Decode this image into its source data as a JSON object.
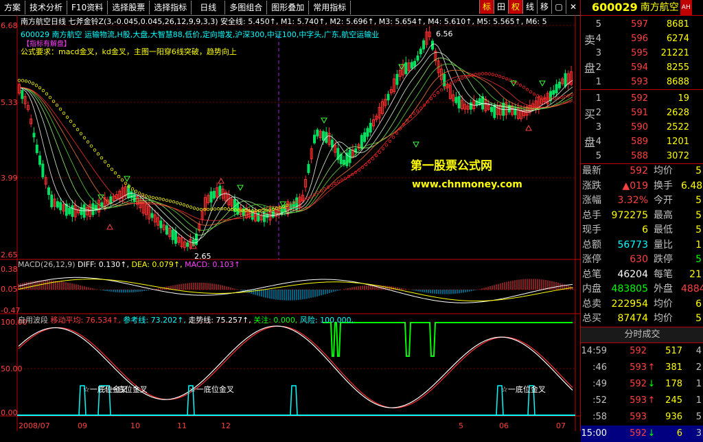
{
  "toolbar": {
    "items": [
      "方案",
      "技术分析",
      "F10资料",
      "选择股票",
      "选择指标",
      "日线",
      "多图组合",
      "图形叠加",
      "常用指标"
    ],
    "right": [
      "标",
      "田",
      "权",
      "线",
      "移",
      "▢",
      "✕"
    ]
  },
  "header": {
    "line1": "南方航空日线  七斧金铃Z(3,-0.045,0.045,26,12,9,9,3,3)  安全线: 5.450↑, M1: 5.740↑, M2: 5.696↑, M3: 5.654↑, M4: 5.610↑, M5: 5.565↑, M6: 5",
    "line2": "600029 南方航空 运输物流,H股,大盘,大智慧88,低价,定向增发,沪深300,中证100,中字头,广东,航空运输业",
    "line3": "公式要求：macd金叉，kd金叉，主图一阳穿6线突破，趋势向上",
    "badge": "【指标有解盘】",
    "watermark1": "第一股票公式网",
    "watermark2": "www.chnmoney.com",
    "low_label": "2.65",
    "high_label": "6.56"
  },
  "yaxis": {
    "price": [
      "6.68",
      "5.33",
      "3.99",
      "2.65"
    ],
    "macd": [
      "0.38",
      "0.05",
      "-0.47"
    ],
    "wave": [
      "100.00",
      "50.00",
      "0.00"
    ]
  },
  "macd": {
    "title": "MACD(26,12,9)",
    "diff": "DIFF: 0.130↑,",
    "dea": "DEA: 0.079↑,",
    "macd": "MACD: 0.103↑"
  },
  "wave": {
    "title": "自用波段",
    "ma": "移动平均: 76.534↑,",
    "ref": "参考线: 73.202↑,",
    "trend": "走势线: 75.257↑,",
    "focus": "关注: 0.000,",
    "risk": "风险: 100.000,",
    "labels": [
      "☆一底位金叉",
      "☆一底位金叉",
      "☆一底位金叉",
      "☆一底位金叉"
    ]
  },
  "xaxis": [
    "2008/07",
    "09",
    "10",
    "11",
    "12",
    "5",
    "06",
    "07"
  ],
  "quote": {
    "code": "600029",
    "name": "南方航空",
    "tag": "AH",
    "sell_label": [
      "卖",
      "盘"
    ],
    "buy_label": [
      "买",
      "盘"
    ],
    "sells": [
      {
        "n": "5",
        "p": "597",
        "v": "8681"
      },
      {
        "n": "4",
        "p": "596",
        "v": "6274"
      },
      {
        "n": "3",
        "p": "595",
        "v": "21221"
      },
      {
        "n": "2",
        "p": "594",
        "v": "8255"
      },
      {
        "n": "1",
        "p": "593",
        "v": "8688"
      }
    ],
    "buys": [
      {
        "n": "1",
        "p": "592",
        "v": "19"
      },
      {
        "n": "2",
        "p": "591",
        "v": "2628"
      },
      {
        "n": "3",
        "p": "590",
        "v": "2522"
      },
      {
        "n": "4",
        "p": "589",
        "v": "1201"
      },
      {
        "n": "5",
        "p": "588",
        "v": "3072"
      }
    ],
    "stats": [
      {
        "l": "最新",
        "v": "592",
        "vc": "red",
        "l2": "均价",
        "v2": "5",
        "v2c": "yellow"
      },
      {
        "l": "涨跌",
        "v": "▲019",
        "vc": "red",
        "l2": "换手",
        "v2": "6.48",
        "v2c": "yellow"
      },
      {
        "l": "涨幅",
        "v": "3.32%",
        "vc": "red",
        "l2": "今开",
        "v2": "5",
        "v2c": "yellow"
      },
      {
        "l": "总手",
        "v": "972275",
        "vc": "yellow",
        "l2": "最高",
        "v2": "5",
        "v2c": "yellow"
      },
      {
        "l": "现手",
        "v": "6",
        "vc": "yellow",
        "l2": "最低",
        "v2": "5",
        "v2c": "yellow"
      },
      {
        "l": "总额",
        "v": "56773",
        "vc": "cyan",
        "l2": "量比",
        "v2": "1",
        "v2c": "yellow"
      },
      {
        "l": "涨停",
        "v": "630",
        "vc": "red",
        "l2": "跌停",
        "v2": "5",
        "v2c": "green"
      },
      {
        "l": "总笔",
        "v": "46204",
        "vc": "white",
        "l2": "每笔",
        "v2": "21",
        "v2c": "yellow"
      },
      {
        "l": "内盘",
        "v": "483805",
        "vc": "green",
        "l2": "外盘",
        "v2": "4884",
        "v2c": "red"
      },
      {
        "l": "总卖",
        "v": "222954",
        "vc": "yellow",
        "l2": "均价",
        "v2": "6",
        "v2c": "yellow"
      },
      {
        "l": "总买",
        "v": "87474",
        "vc": "yellow",
        "l2": "均价",
        "v2": "5",
        "v2c": "yellow"
      }
    ],
    "tick_title": "分时成交",
    "ticks": [
      {
        "t": "14:59",
        "p": "592",
        "a": "",
        "ac": "red",
        "v": "517",
        "s": "4"
      },
      {
        "t": ":46",
        "p": "593",
        "a": "↑",
        "ac": "red",
        "v": "381",
        "s": "2"
      },
      {
        "t": ":49",
        "p": "592",
        "a": "↓",
        "ac": "green",
        "v": "178",
        "s": "1"
      },
      {
        "t": ":52",
        "p": "593",
        "a": "↑",
        "ac": "red",
        "v": "245",
        "s": "1"
      },
      {
        "t": ":58",
        "p": "593",
        "a": "",
        "ac": "red",
        "v": "936",
        "s": "5"
      },
      {
        "t": "15:00",
        "p": "592",
        "a": "↓",
        "ac": "green",
        "v": "6",
        "s": "3"
      }
    ]
  }
}
